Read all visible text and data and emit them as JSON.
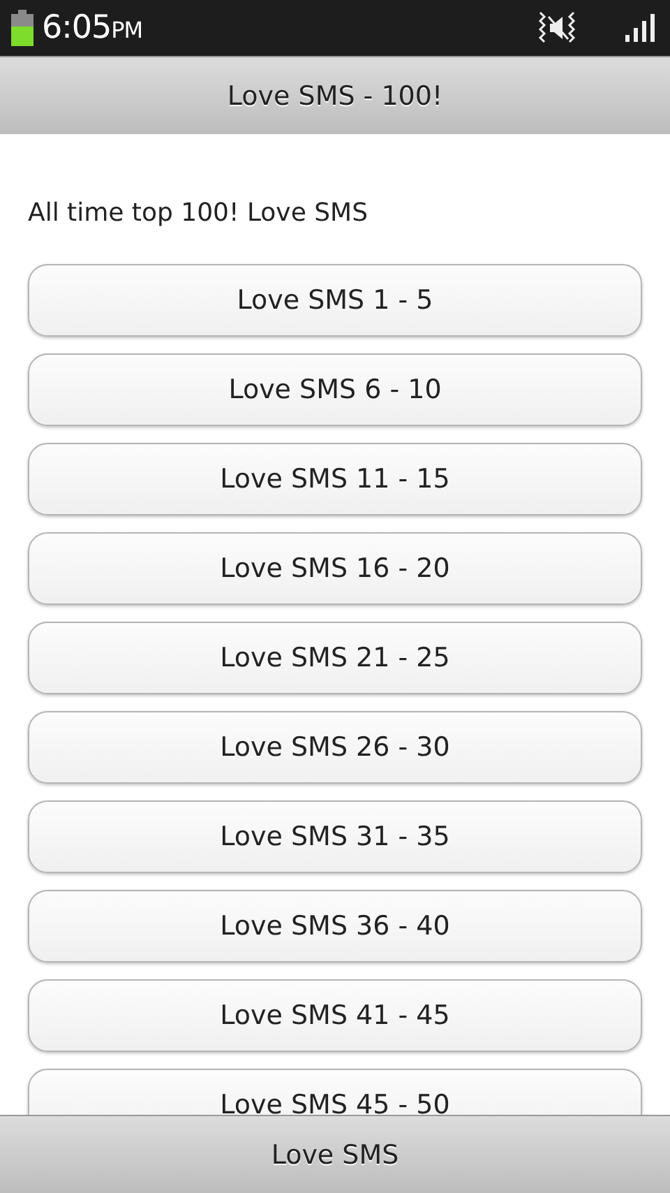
{
  "status_bar": {
    "time": "6:05",
    "ampm": "PM"
  },
  "header": {
    "title": "Love SMS - 100!"
  },
  "intro": "All time top 100! Love SMS",
  "buttons": [
    "Love SMS 1 - 5",
    "Love SMS 6 - 10",
    "Love SMS 11 - 15",
    "Love SMS 16 - 20",
    "Love SMS 21 - 25",
    "Love SMS 26 - 30",
    "Love SMS 31 - 35",
    "Love SMS 36 - 40",
    "Love SMS 41 - 45",
    "Love SMS 45 - 50"
  ],
  "footer": {
    "title": "Love SMS"
  }
}
